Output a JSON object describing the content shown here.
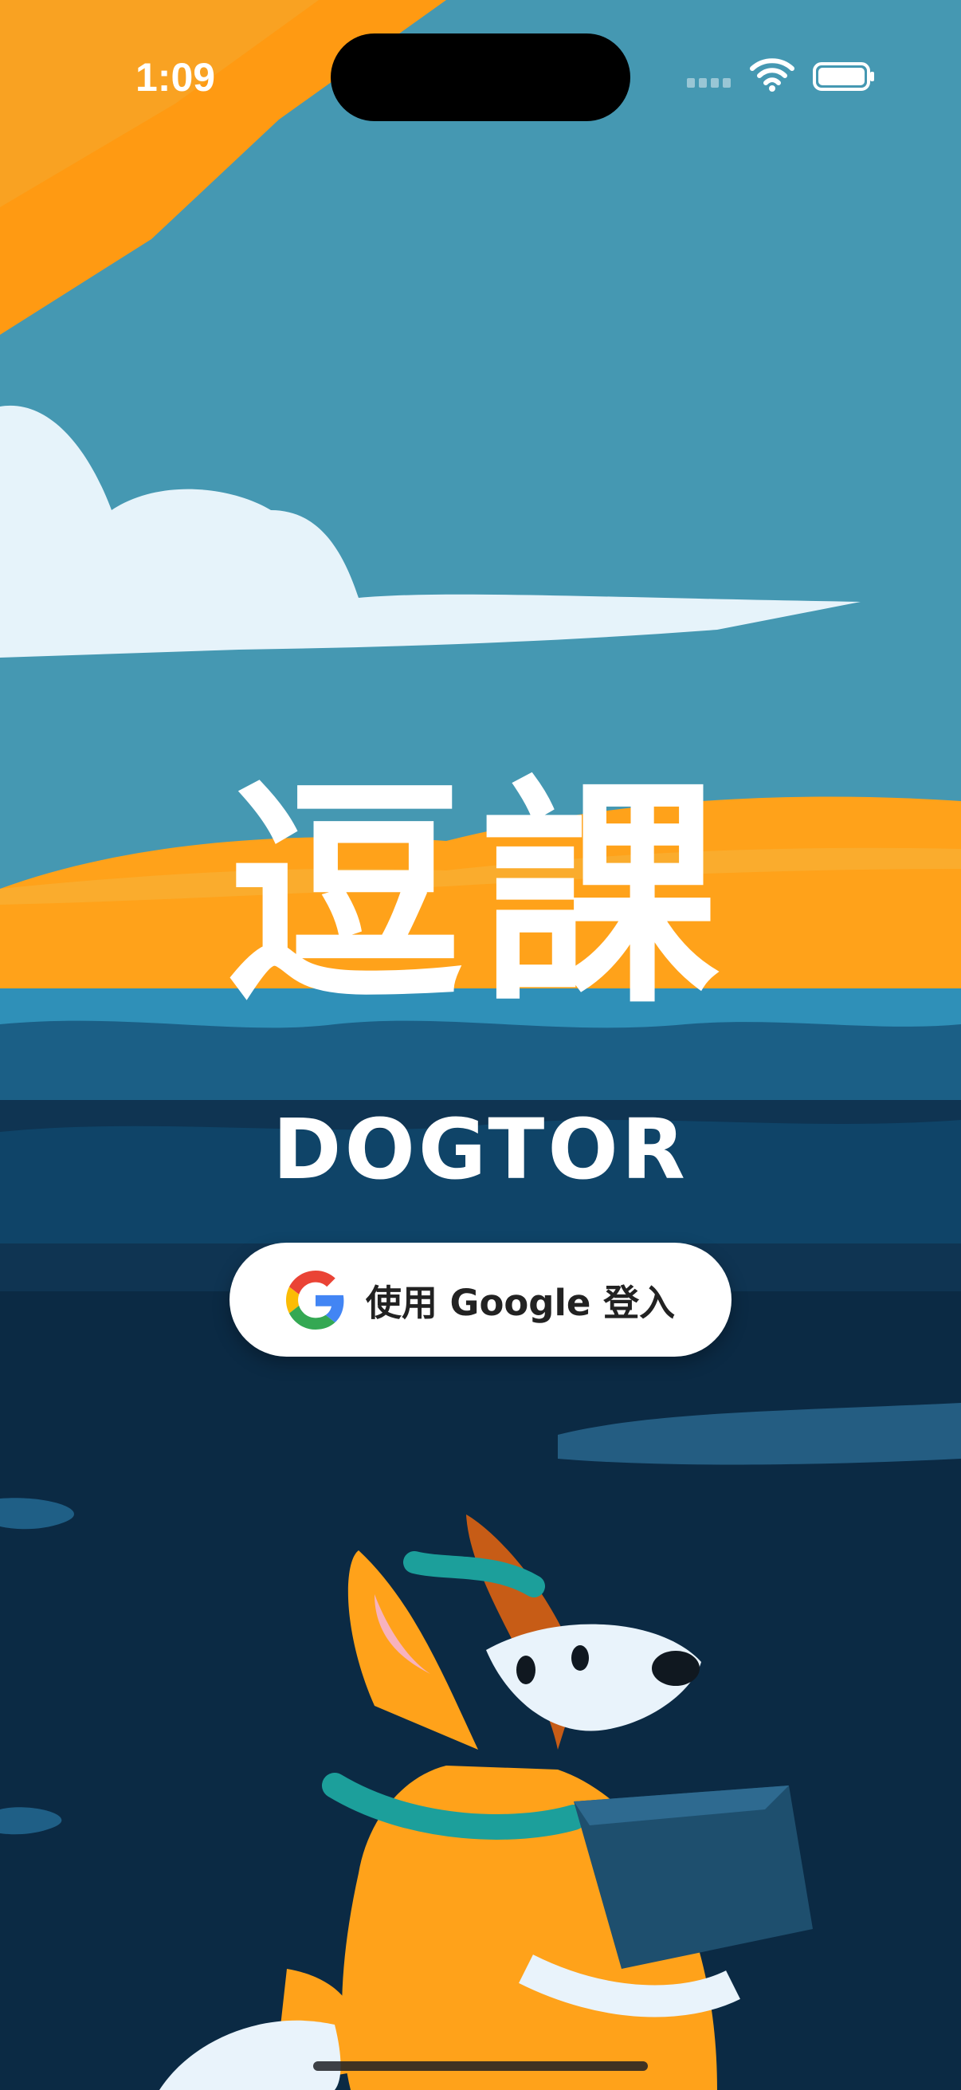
{
  "status_bar": {
    "time": "1:09",
    "icons": [
      "cellular-icon",
      "wifi-icon",
      "battery-icon"
    ]
  },
  "app": {
    "title_cjk": "逗課",
    "title_en": "DOGTOR"
  },
  "login": {
    "label": "使用 Google 登入",
    "icon": "google-logo-icon"
  },
  "colors": {
    "sky": "#4598b2",
    "orange": "#ffa21a",
    "cloud": "#e6f3fa",
    "sea": "#0f3452",
    "sea_dark": "#0b2a44"
  }
}
